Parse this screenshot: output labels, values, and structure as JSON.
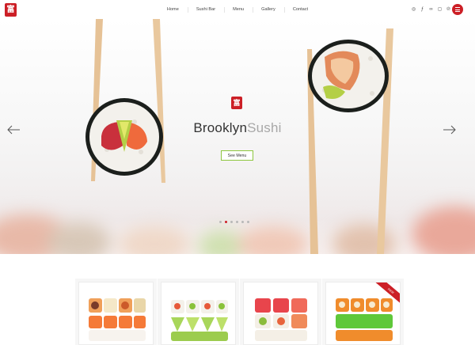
{
  "header": {
    "logo_glyph": "富",
    "nav": [
      {
        "label": "Home"
      },
      {
        "label": "Sushi Bar"
      },
      {
        "label": "Menu"
      },
      {
        "label": "Gallery"
      },
      {
        "label": "Contact"
      }
    ],
    "socials": [
      {
        "icon": "whatsapp-icon",
        "glyph": "◎"
      },
      {
        "icon": "foursquare-icon",
        "glyph": "ƒ"
      },
      {
        "icon": "tripadvisor-icon",
        "glyph": "∞"
      },
      {
        "icon": "instagram-icon",
        "glyph": "◻"
      },
      {
        "icon": "pinterest-icon",
        "glyph": "℗"
      }
    ],
    "menu_icon": "hamburger-icon"
  },
  "hero": {
    "logo_glyph": "富",
    "title_bold": "Brooklyn",
    "title_light": "Sushi",
    "button_label": "See Menu",
    "slide_count": 6,
    "active_slide": 1,
    "prev_icon": "arrow-left-icon",
    "next_icon": "arrow-right-icon"
  },
  "products": [
    {
      "name": "salmon-roll-set",
      "badge": ""
    },
    {
      "name": "avocado-roll-set",
      "badge": ""
    },
    {
      "name": "tuna-roll-set",
      "badge": ""
    },
    {
      "name": "green-tobiko-roll-set",
      "badge": "new"
    }
  ],
  "colors": {
    "brand": "#cc1f26",
    "accent": "#8ec63f"
  }
}
